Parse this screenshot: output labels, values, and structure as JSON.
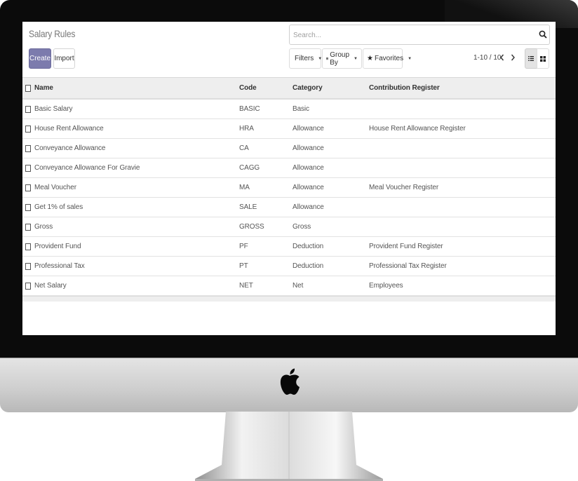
{
  "title": "Salary Rules",
  "search": {
    "placeholder": "Search..."
  },
  "buttons": {
    "create": "Create",
    "import": "Import"
  },
  "filters": {
    "filters": "Filters",
    "group_by": "Group By",
    "favorites": "Favorites"
  },
  "pager": {
    "value": "1-10 / 10"
  },
  "columns": {
    "name": "Name",
    "code": "Code",
    "category": "Category",
    "register": "Contribution Register"
  },
  "rows": [
    {
      "name": "Basic Salary",
      "code": "BASIC",
      "category": "Basic",
      "register": ""
    },
    {
      "name": "House Rent Allowance",
      "code": "HRA",
      "category": "Allowance",
      "register": "House Rent Allowance Register"
    },
    {
      "name": "Conveyance Allowance",
      "code": "CA",
      "category": "Allowance",
      "register": ""
    },
    {
      "name": "Conveyance Allowance For Gravie",
      "code": "CAGG",
      "category": "Allowance",
      "register": ""
    },
    {
      "name": "Meal Voucher",
      "code": "MA",
      "category": "Allowance",
      "register": "Meal Voucher Register"
    },
    {
      "name": "Get 1% of sales",
      "code": "SALE",
      "category": "Allowance",
      "register": ""
    },
    {
      "name": "Gross",
      "code": "GROSS",
      "category": "Gross",
      "register": ""
    },
    {
      "name": "Provident Fund",
      "code": "PF",
      "category": "Deduction",
      "register": "Provident Fund Register"
    },
    {
      "name": "Professional Tax",
      "code": "PT",
      "category": "Deduction",
      "register": "Professional Tax Register"
    },
    {
      "name": "Net Salary",
      "code": "NET",
      "category": "Net",
      "register": "Employees"
    }
  ],
  "colors": {
    "primary": "#7c7bad",
    "header_bg": "#eeeeee",
    "bezel": "#0b0b0b",
    "chin": "#cfcfcf"
  },
  "icons": {
    "search": "search-icon",
    "filter": "funnel-icon",
    "group": "bars-icon",
    "favorites": "star-icon",
    "brand": "apple-logo-icon"
  }
}
